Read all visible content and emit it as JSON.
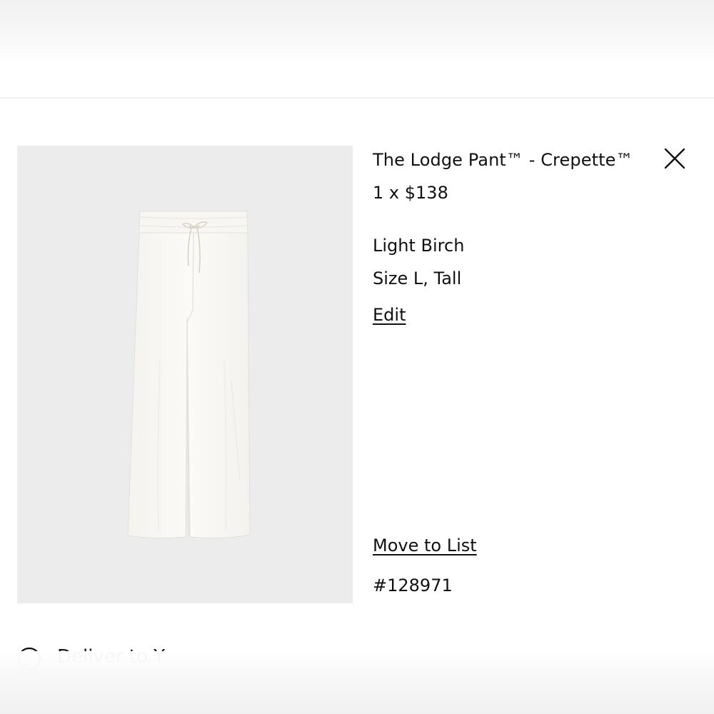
{
  "product": {
    "title": "The Lodge Pant™ - Crepette™",
    "quantity": "1",
    "qty_separator": "x",
    "price": "$138",
    "color": "Light Birch",
    "size": "Size L, Tall",
    "edit_label": "Edit",
    "move_to_list_label": "Move to List",
    "sku": "#128971",
    "image_icon": "pants-product-photo"
  },
  "icons": {
    "close": "close-icon"
  },
  "bottom_partial": {
    "text": "Deliver to Y"
  },
  "colors": {
    "image_background": "#ececed",
    "text": "#111111"
  }
}
